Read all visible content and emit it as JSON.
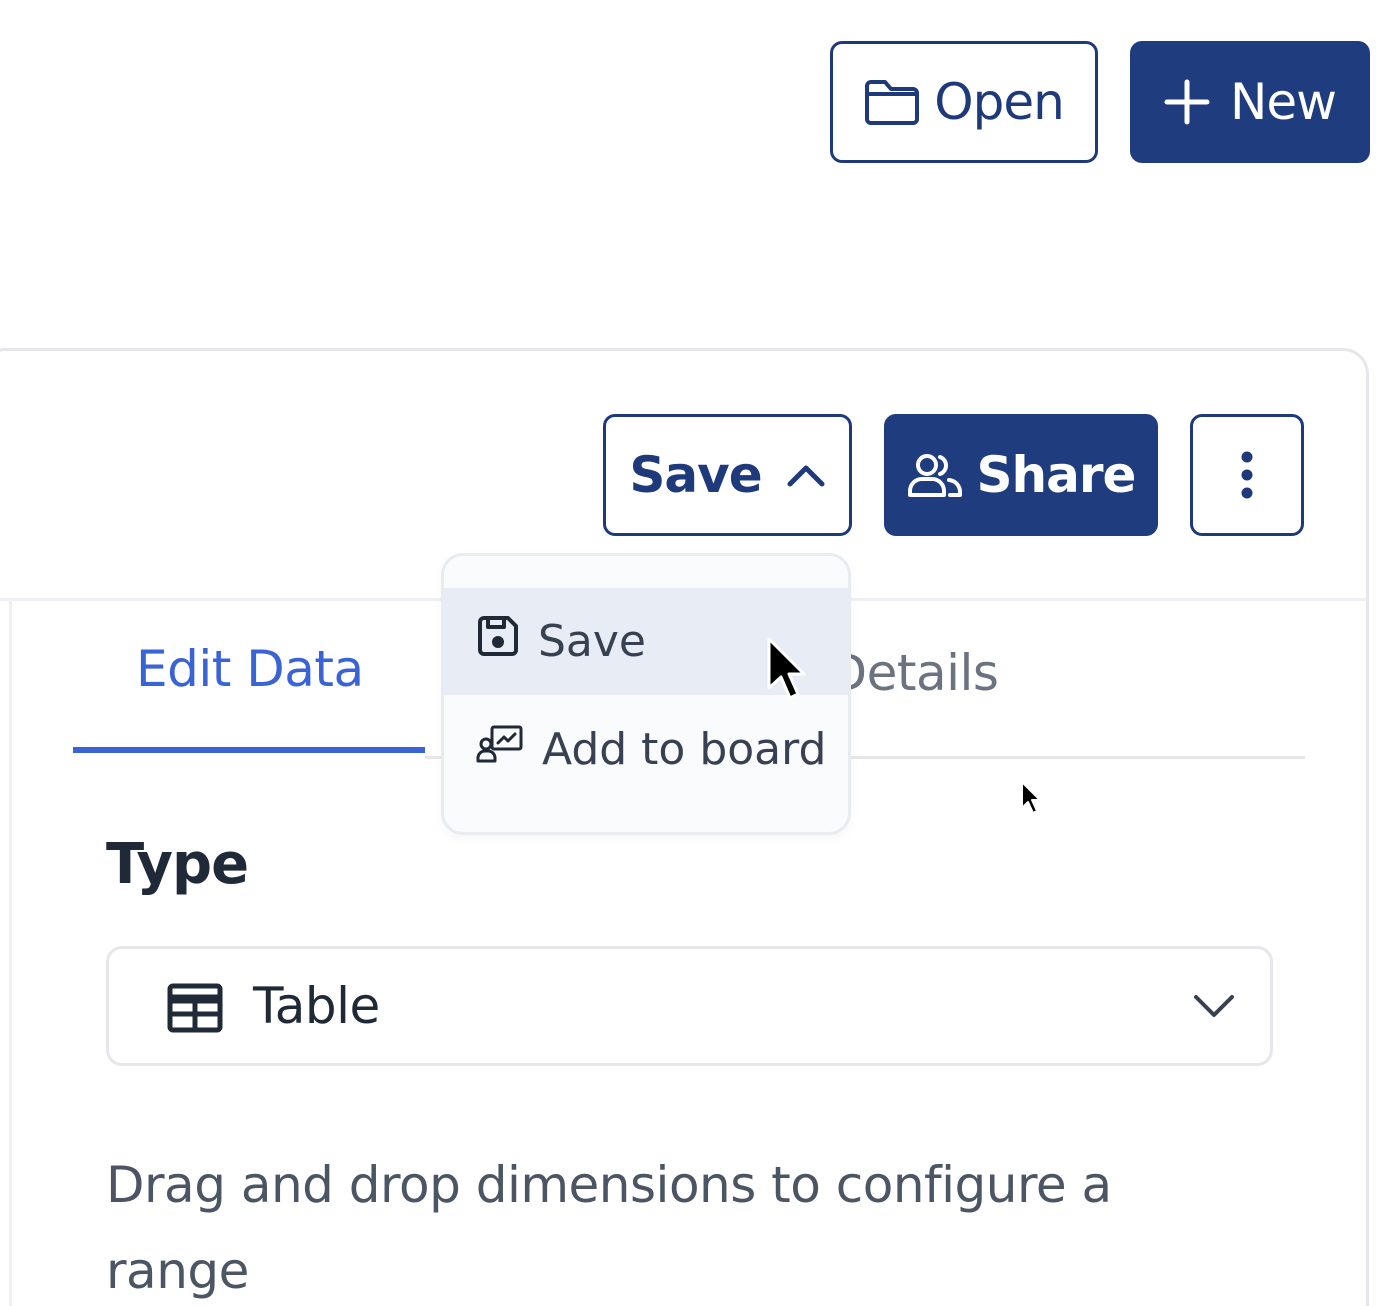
{
  "toolbar": {
    "open_label": "Open",
    "new_label": "New"
  },
  "card": {
    "save_label": "Save",
    "share_label": "Share"
  },
  "save_menu": {
    "items": [
      {
        "label": "Save",
        "icon": "save-icon",
        "highlighted": true
      },
      {
        "label": "Add to board",
        "icon": "add-to-board-icon",
        "highlighted": false
      }
    ]
  },
  "tabs": [
    {
      "label": "Edit Data",
      "active": true
    },
    {
      "label": "Format Details",
      "visible_text": "nat Details",
      "active": false
    }
  ],
  "type_section": {
    "title": "Type",
    "selected_value": "Table",
    "selected_icon": "table-icon"
  },
  "help_text": "Drag and drop dimensions to configure a range",
  "colors": {
    "primary": "#1f3c7e",
    "accent": "#3a63d6",
    "border": "#e5e7eb",
    "menu_highlight": "#e8ecf4"
  }
}
